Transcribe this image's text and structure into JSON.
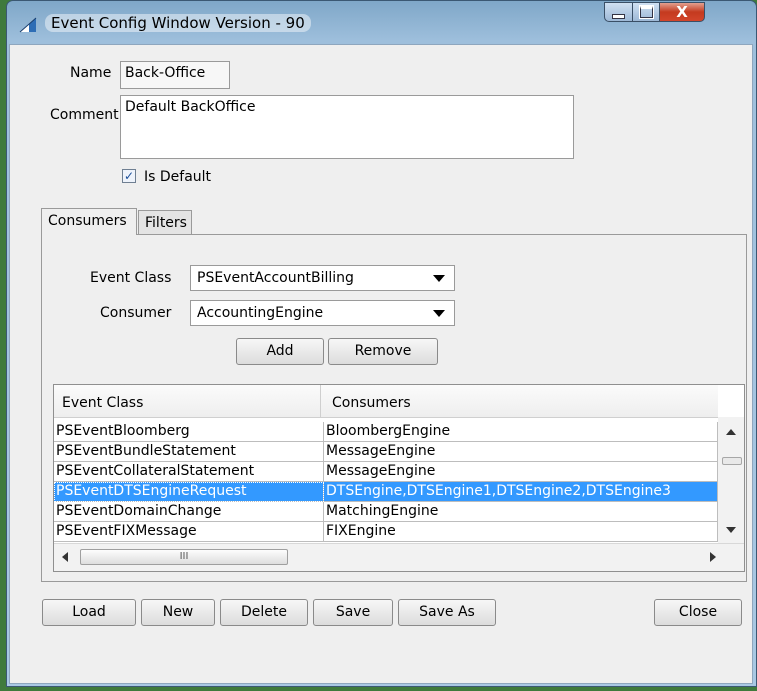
{
  "window": {
    "title": "Event Config Window  Version - 90",
    "controls": {
      "minimize": "minimize-icon",
      "maximize": "maximize-icon",
      "close": "X"
    }
  },
  "form": {
    "name_label": "Name",
    "name_value": "Back-Office",
    "comment_label": "Comment",
    "comment_value": "Default BackOffice",
    "is_default_label": "Is Default",
    "is_default_checked": true
  },
  "tabs": [
    {
      "label": "Consumers",
      "active": true
    },
    {
      "label": "Filters",
      "active": false
    }
  ],
  "consumers_tab": {
    "event_class_label": "Event Class",
    "event_class_value": "PSEventAccountBilling",
    "consumer_label": "Consumer",
    "consumer_value": "AccountingEngine",
    "add_label": "Add",
    "remove_label": "Remove"
  },
  "table": {
    "columns": [
      "Event Class",
      "Consumers"
    ],
    "rows": [
      {
        "event_class": "PSEventBloomberg",
        "consumers": "BloombergEngine"
      },
      {
        "event_class": "PSEventBundleStatement",
        "consumers": "MessageEngine"
      },
      {
        "event_class": "PSEventCollateralStatement",
        "consumers": "MessageEngine"
      },
      {
        "event_class": "PSEventDTSEngineRequest",
        "consumers": "DTSEngine,DTSEngine1,DTSEngine2,DTSEngine3",
        "selected": true
      },
      {
        "event_class": "PSEventDomainChange",
        "consumers": "MatchingEngine"
      },
      {
        "event_class": "PSEventFIXMessage",
        "consumers": "FIXEngine"
      }
    ],
    "hscroll_thumb_grip": "III"
  },
  "footer": {
    "load_label": "Load",
    "new_label": "New",
    "delete_label": "Delete",
    "save_label": "Save",
    "save_as_label": "Save As",
    "close_label": "Close"
  },
  "colors": {
    "selection": "#3399ff",
    "titlebar": "#9ebfdc",
    "panel": "#efefef"
  }
}
